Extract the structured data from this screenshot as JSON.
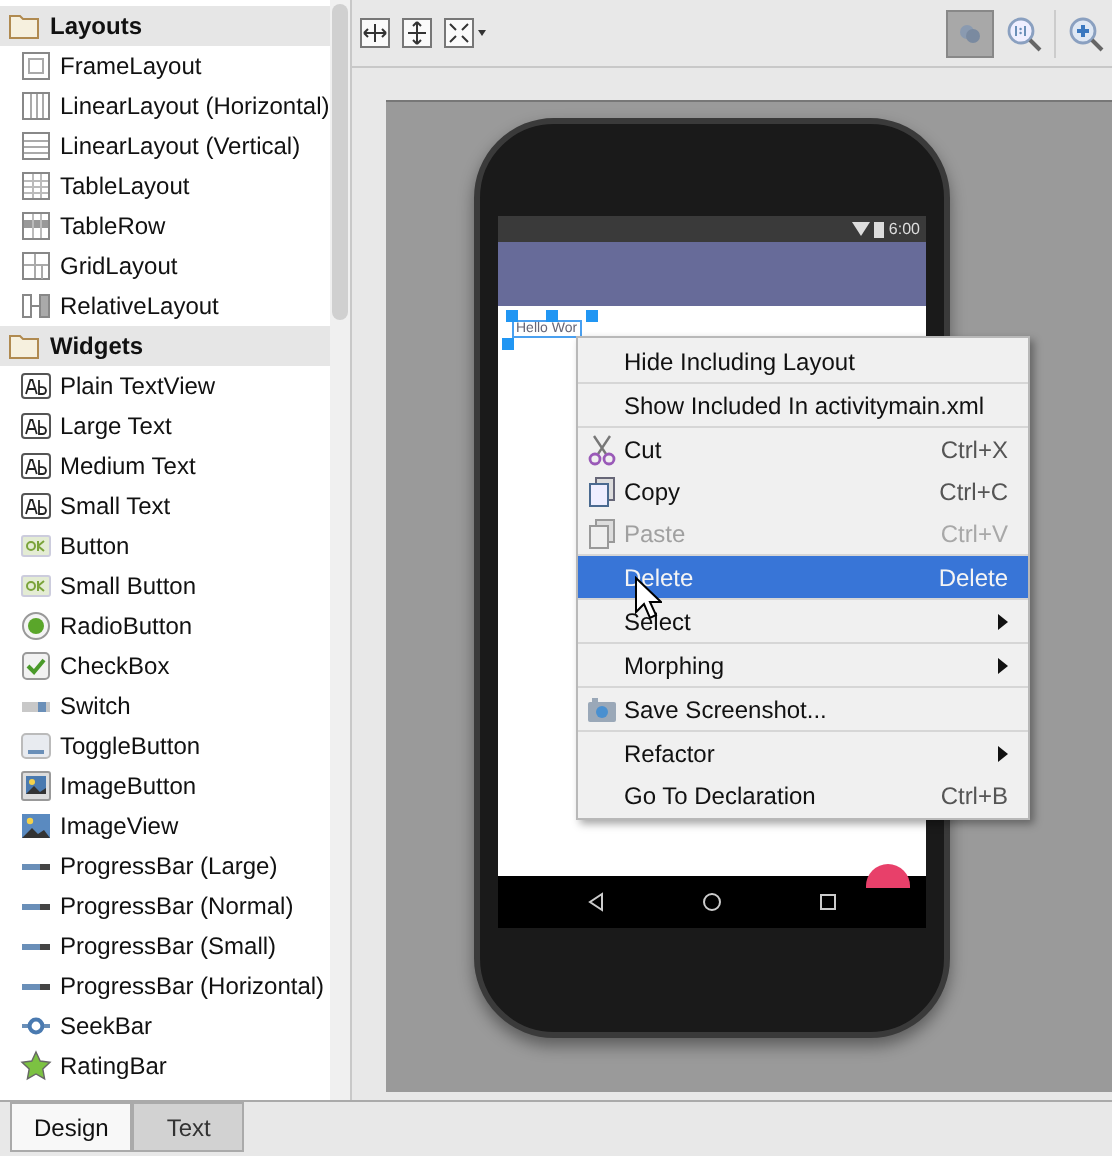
{
  "palette": {
    "groups": [
      {
        "title": "Layouts",
        "items": [
          {
            "label": "FrameLayout",
            "kind": "frame"
          },
          {
            "label": "LinearLayout (Horizontal)",
            "kind": "hlinear"
          },
          {
            "label": "LinearLayout (Vertical)",
            "kind": "vlinear"
          },
          {
            "label": "TableLayout",
            "kind": "table"
          },
          {
            "label": "TableRow",
            "kind": "tablerow"
          },
          {
            "label": "GridLayout",
            "kind": "grid"
          },
          {
            "label": "RelativeLayout",
            "kind": "relative"
          }
        ]
      },
      {
        "title": "Widgets",
        "items": [
          {
            "label": "Plain TextView",
            "kind": "text"
          },
          {
            "label": "Large Text",
            "kind": "text"
          },
          {
            "label": "Medium Text",
            "kind": "text"
          },
          {
            "label": "Small Text",
            "kind": "text"
          },
          {
            "label": "Button",
            "kind": "button"
          },
          {
            "label": "Small Button",
            "kind": "button"
          },
          {
            "label": "RadioButton",
            "kind": "radio"
          },
          {
            "label": "CheckBox",
            "kind": "checkbox"
          },
          {
            "label": "Switch",
            "kind": "switch"
          },
          {
            "label": "ToggleButton",
            "kind": "toggle"
          },
          {
            "label": "ImageButton",
            "kind": "imagebutton"
          },
          {
            "label": "ImageView",
            "kind": "imageview"
          },
          {
            "label": "ProgressBar (Large)",
            "kind": "progress"
          },
          {
            "label": "ProgressBar (Normal)",
            "kind": "progress"
          },
          {
            "label": "ProgressBar (Small)",
            "kind": "progress"
          },
          {
            "label": "ProgressBar (Horizontal)",
            "kind": "progress"
          },
          {
            "label": "SeekBar",
            "kind": "seek"
          },
          {
            "label": "RatingBar",
            "kind": "rating"
          }
        ]
      }
    ]
  },
  "device": {
    "time": "6:00",
    "selected_text": "Hello Wor"
  },
  "context_menu": {
    "groups": [
      [
        {
          "label": "Hide Including Layout",
          "disabled": false,
          "selected": false
        }
      ],
      [
        {
          "label": "Show Included In activitymain.xml",
          "disabled": false,
          "selected": false
        }
      ],
      [
        {
          "label": "Cut",
          "shortcut": "Ctrl+X",
          "kind": "scissors",
          "disabled": false,
          "selected": false
        },
        {
          "label": "Copy",
          "shortcut": "Ctrl+C",
          "kind": "copy",
          "disabled": false,
          "selected": false
        },
        {
          "label": "Paste",
          "shortcut": "Ctrl+V",
          "kind": "paste",
          "disabled": true,
          "selected": false
        }
      ],
      [
        {
          "label": "Delete",
          "shortcut": "Delete",
          "disabled": false,
          "selected": true
        }
      ],
      [
        {
          "label": "Select",
          "submenu": true,
          "disabled": false,
          "selected": false
        }
      ],
      [
        {
          "label": "Morphing",
          "submenu": true,
          "disabled": false,
          "selected": false
        }
      ],
      [
        {
          "label": "Save Screenshot...",
          "kind": "camera",
          "disabled": false,
          "selected": false
        }
      ],
      [
        {
          "label": "Refactor",
          "submenu": true,
          "disabled": false,
          "selected": false
        },
        {
          "label": "Go To Declaration",
          "shortcut": "Ctrl+B",
          "disabled": false,
          "selected": false
        }
      ]
    ]
  },
  "bottom_tabs": [
    {
      "label": "Design",
      "selected": true
    },
    {
      "label": "Text",
      "selected": false
    }
  ]
}
